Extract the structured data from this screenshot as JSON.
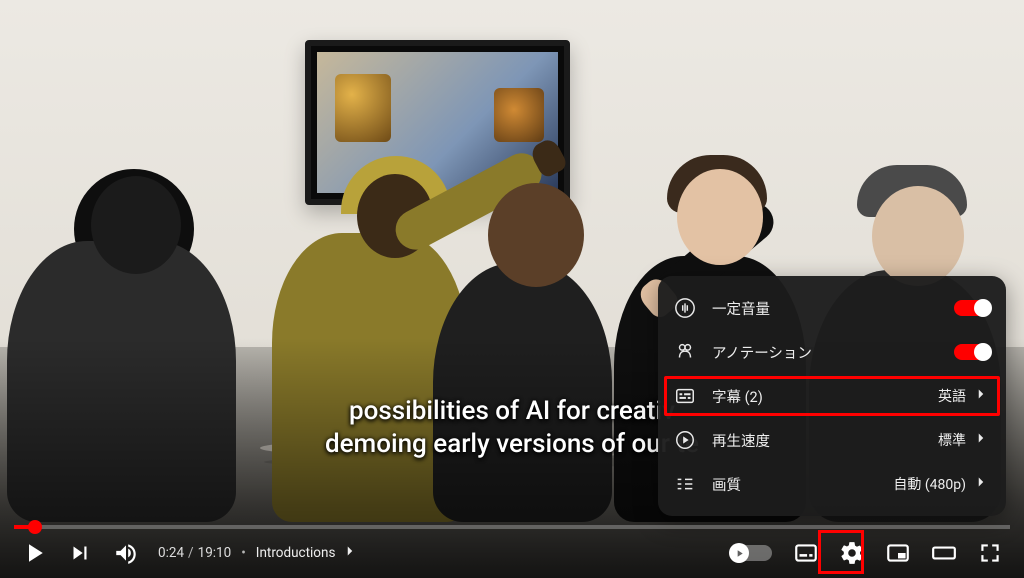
{
  "captions": {
    "line1": "possibilities of AI for creativ",
    "line2": "demoing early versions of our te"
  },
  "time": {
    "current": "0:24",
    "duration": "19:10",
    "sep1": "/",
    "dot": "•"
  },
  "chapter": {
    "label": "Introductions"
  },
  "settings_menu": {
    "items": [
      {
        "icon": "stable-volume-icon",
        "label": "一定音量",
        "has_toggle": true
      },
      {
        "icon": "annotations-icon",
        "label": "アノテーション",
        "has_toggle": true
      },
      {
        "icon": "subtitles-icon",
        "label": "字幕 (2)",
        "value": "英語",
        "has_chevron": true,
        "highlighted": true
      },
      {
        "icon": "playback-speed-icon",
        "label": "再生速度",
        "value": "標準",
        "has_chevron": true
      },
      {
        "icon": "quality-icon",
        "label": "画質",
        "value": "自動 (480p)",
        "has_chevron": true
      }
    ]
  }
}
